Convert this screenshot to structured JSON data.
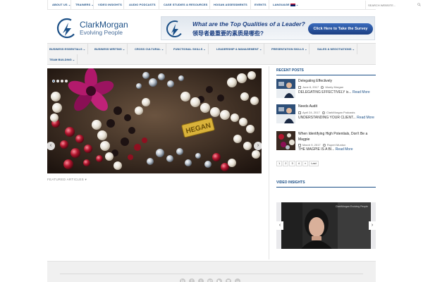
{
  "topnav": {
    "items": [
      {
        "label": "ABOUT US",
        "caret": "⌄"
      },
      {
        "label": "TRAINERS",
        "caret": "⌄"
      },
      {
        "label": "VIDEO INSIGHTS",
        "caret": ""
      },
      {
        "label": "AUDIO PODCASTS",
        "caret": ""
      },
      {
        "label": "CASE STUDIES & RESOURCES",
        "caret": ""
      },
      {
        "label": "HOGAN ASSESSMENTS",
        "caret": ""
      },
      {
        "label": "EVENTS",
        "caret": ""
      },
      {
        "label": "LANGUAGE",
        "caret": "⌄"
      }
    ],
    "search_placeholder": "SEARCH WEBSITE..."
  },
  "logo": {
    "name": "ClarkMorgan",
    "tagline": "Evolving People"
  },
  "banner": {
    "question": "What are the Top Qualities of a Leader?",
    "question_cn": "领导者最重要的素质是哪些?",
    "button": "Click Here to Take the Survey"
  },
  "catnav": {
    "items": [
      {
        "label": "BUSINESS ESSENTIALS"
      },
      {
        "label": "BUSINESS WRITING"
      },
      {
        "label": "CROSS CULTURAL"
      },
      {
        "label": "FUNCTIONAL SKILLS"
      },
      {
        "label": "LEADERSHIP & MANAGEMENT"
      },
      {
        "label": "PRESENTATION SKILLS"
      },
      {
        "label": "SALES & NEGOTIATIONS"
      },
      {
        "label": "TEAM BUILDING"
      }
    ],
    "caret": "⌄"
  },
  "slider": {
    "featured_label": "FEATURED ARTICLES ▾",
    "image_text": "HEGAN",
    "prev": "‹",
    "next": "›"
  },
  "recent_posts": {
    "title": "RECENT POSTS",
    "posts": [
      {
        "title": "Delegating Effectively",
        "date": "June 8, 2017",
        "author": "Monty Morgan",
        "excerpt": "DELEGATING EFFECTIVELY is...",
        "more": "Read More"
      },
      {
        "title": "Needs Audit",
        "date": "April 24, 2017",
        "author": "ClarkMorgan Podcasts",
        "excerpt": "UNDERSTANDING YOUR CLIENT...",
        "more": "Read More"
      },
      {
        "title": "When Identifying High Potentials, Don't Be a Magpie",
        "date": "March 9, 2017",
        "author": "Rupert Munton",
        "excerpt": "THE MAGPIE IS A BI...",
        "more": "Read More"
      }
    ],
    "pages": [
      "1",
      "2",
      "3",
      "4",
      "»",
      "Last"
    ]
  },
  "video_insights": {
    "title": "VIDEO INSIGHTS",
    "logo_text": "ClarkMorgan Evolving People",
    "prev": "‹",
    "next": "›"
  },
  "footer": {
    "social": [
      "in",
      "f",
      "t",
      "g+",
      "▶",
      "✉",
      "rss"
    ]
  }
}
